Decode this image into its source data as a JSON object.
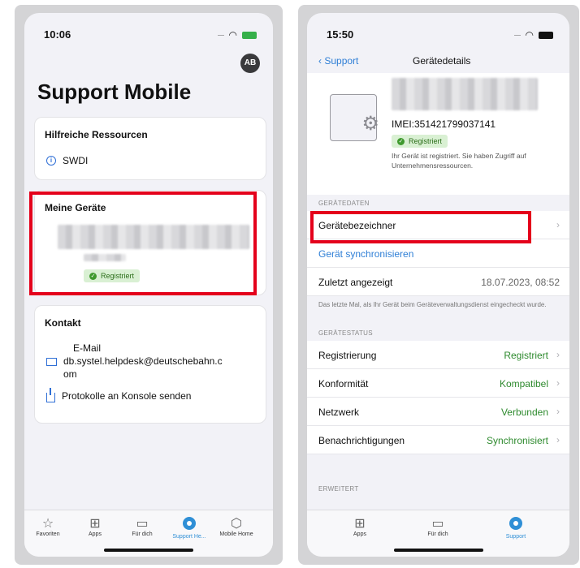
{
  "left_phone": {
    "status_time": "10:06",
    "avatar_initials": "AB",
    "title": "Support Mobile",
    "resources": {
      "heading": "Hilfreiche Ressourcen",
      "item": "SWDI"
    },
    "devices": {
      "heading": "Meine Geräte",
      "status_badge": "Registriert"
    },
    "contact": {
      "heading": "Kontakt",
      "email_label": "E-Mail",
      "email_line1": "db.systel.helpdesk@deutschebahn.c",
      "email_line2": "om",
      "send_logs": "Protokolle an Konsole senden"
    },
    "tabs": [
      "Favoriten",
      "Apps",
      "Für dich",
      "Support He...",
      "Mobile Home"
    ],
    "active_tab": "Support He..."
  },
  "right_phone": {
    "status_time": "15:50",
    "nav": {
      "back": "Support",
      "title": "Gerätedetails"
    },
    "device": {
      "imei": "IMEI:351421799037141",
      "badge": "Registriert",
      "description": "Ihr Gerät ist registriert. Sie haben Zugriff auf Unternehmensressourcen."
    },
    "device_data": {
      "section": "GERÄTEDATEN",
      "identifier": "Gerätebezeichner",
      "sync": "Gerät synchronisieren",
      "last_seen_label": "Zuletzt angezeigt",
      "last_seen_value": "18.07.2023, 08:52",
      "note": "Das letzte Mal, als Ihr Gerät beim Geräteverwaltungsdienst eingecheckt wurde."
    },
    "device_status": {
      "section": "GERÄTESTATUS",
      "rows": [
        {
          "label": "Registrierung",
          "value": "Registriert"
        },
        {
          "label": "Konformität",
          "value": "Kompatibel"
        },
        {
          "label": "Netzwerk",
          "value": "Verbunden"
        },
        {
          "label": "Benachrichtigungen",
          "value": "Synchronisiert"
        }
      ]
    },
    "advanced_section": "ERWEITERT",
    "tabs": [
      "Apps",
      "Für dich",
      "Support"
    ],
    "active_tab": "Support"
  },
  "colors": {
    "highlight": "#e4001b",
    "accent": "#2f7fd6",
    "status_green": "#2e8a2e"
  }
}
